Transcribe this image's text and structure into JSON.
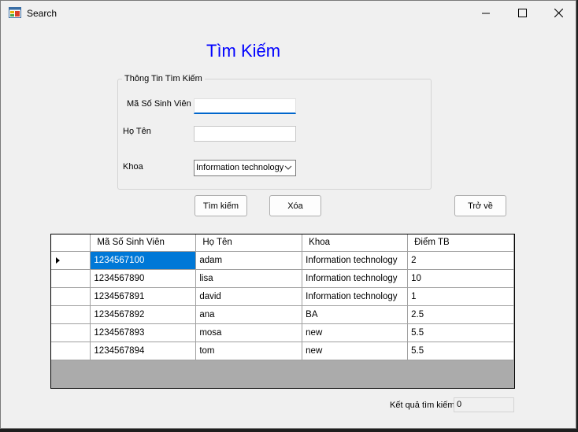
{
  "window": {
    "title": "Search"
  },
  "heading": "Tìm Kiếm",
  "search_group": {
    "title": "Thông Tin Tìm Kiếm",
    "student_id_label": "Mã Số Sinh Viên",
    "student_id_value": "",
    "name_label": "Họ Tên",
    "name_value": "",
    "faculty_label": "Khoa",
    "faculty_selected": "Information technology"
  },
  "buttons": {
    "search": "Tìm kiếm",
    "clear": "Xóa",
    "back": "Trở về"
  },
  "table": {
    "columns": [
      "Mã Số Sinh Viên",
      "Họ Tên",
      "Khoa",
      "Điểm TB"
    ],
    "rows": [
      [
        "1234567100",
        "adam",
        "Information technology",
        "2"
      ],
      [
        "1234567890",
        "lisa",
        "Information technology",
        "10"
      ],
      [
        "1234567891",
        "david",
        "Information technology",
        "1"
      ],
      [
        "1234567892",
        "ana",
        "BA",
        "2.5"
      ],
      [
        "1234567893",
        "mosa",
        "new",
        "5.5"
      ],
      [
        "1234567894",
        "tom",
        "new",
        "5.5"
      ]
    ],
    "selected_row": 0
  },
  "result": {
    "label": "Kết quả tìm kiếm",
    "value": "0"
  },
  "colors": {
    "heading": "#0000ff",
    "selection": "#0078d7",
    "grid_background": "#ababab",
    "focus_underline": "#0066cc"
  },
  "icons": {
    "app": "app-form-icon",
    "minimize": "minimize-icon",
    "maximize": "maximize-icon",
    "close": "close-icon",
    "dropdown": "chevron-down-icon",
    "row_indicator": "row-pointer-icon"
  }
}
